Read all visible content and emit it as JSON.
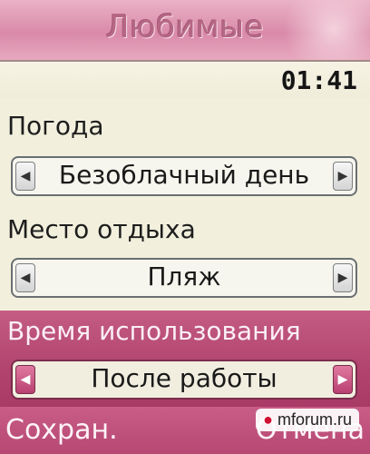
{
  "header": {
    "title": "Любимые"
  },
  "status": {
    "time": "01:41"
  },
  "fields": [
    {
      "label": "Погода",
      "value": "Безоблачный день",
      "focused": false
    },
    {
      "label": "Место отдыха",
      "value": "Пляж",
      "focused": false
    },
    {
      "label": "Время использования",
      "value": "После работы",
      "focused": true
    }
  ],
  "icons": {
    "left": "arrow-left-icon",
    "right": "arrow-right-icon"
  },
  "softkeys": {
    "left": "Сохран.",
    "right": "Отмена"
  },
  "watermark": {
    "text": "mforum.ru"
  },
  "colors": {
    "accent": "#b64873",
    "background": "#f2f0dd",
    "title": "#d98aa8"
  }
}
